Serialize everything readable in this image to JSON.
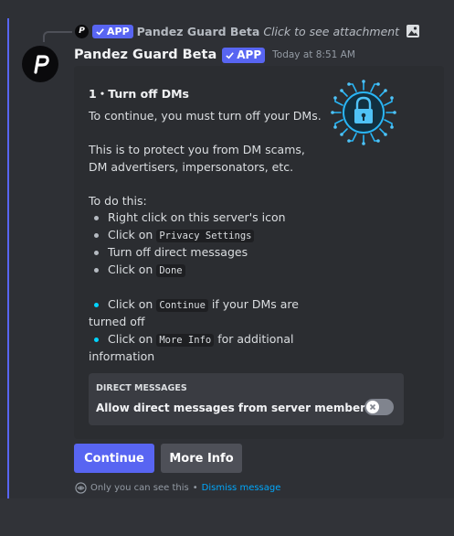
{
  "reply": {
    "badge": "APP",
    "name": "Pandez Guard Beta",
    "text": "Click to see attachment",
    "attachment_icon": "image-icon"
  },
  "message": {
    "author": "Pandez Guard Beta",
    "badge": "APP",
    "timestamp": "Today at 8:51 AM",
    "avatar_icon": "pandez-logo-icon"
  },
  "embed": {
    "title": "1・Turn off DMs",
    "intro": "To continue, you must turn off your DMs.",
    "protect": "This is to protect you from DM scams, DM advertisers, impersonators, etc.",
    "todo": "To do this:",
    "steps": {
      "s1": "Right click on this server's icon",
      "s2_prefix": "Click on",
      "s2_code": "Privacy Settings",
      "s3": "Turn off direct messages",
      "s4_prefix": "Click on",
      "s4_code": "Done"
    },
    "extra": {
      "e1_prefix": "Click on",
      "e1_code": "Continue",
      "e1_suffix": "if your DMs are turned off",
      "e2_prefix": "Click on",
      "e2_code": "More Info",
      "e2_suffix": "for additional information"
    },
    "image_icon": "circuit-lock-icon",
    "toggle_card": {
      "header": "DIRECT MESSAGES",
      "description": "Allow direct messages from server members.",
      "enabled": false
    }
  },
  "buttons": {
    "continue": "Continue",
    "more_info": "More Info"
  },
  "footer": {
    "only_you": "Only you can see this",
    "separator": "•",
    "dismiss": "Dismiss message"
  },
  "colors": {
    "blurple": "#5865f2",
    "link": "#00a8fc",
    "cyan": "#00d4ff"
  }
}
